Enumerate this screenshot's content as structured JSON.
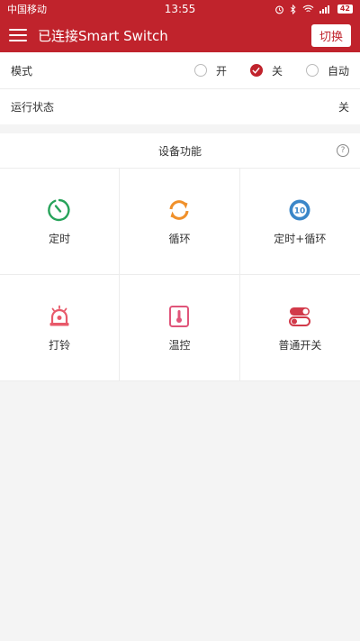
{
  "status_bar": {
    "carrier": "中国移动",
    "time": "13:55",
    "battery": "42"
  },
  "app_bar": {
    "title": "已连接Smart Switch",
    "switch_label": "切换"
  },
  "mode": {
    "label": "模式",
    "options": [
      "开",
      "关",
      "自动"
    ],
    "selected_index": 1
  },
  "run_status": {
    "label": "运行状态",
    "value": "关"
  },
  "features": {
    "title": "设备功能",
    "help": "?",
    "items": [
      {
        "label": "定时",
        "icon": "timer-icon"
      },
      {
        "label": "循环",
        "icon": "loop-icon"
      },
      {
        "label": "定时+循环",
        "icon": "timer-loop-icon"
      },
      {
        "label": "打铃",
        "icon": "bell-icon"
      },
      {
        "label": "温控",
        "icon": "thermometer-icon"
      },
      {
        "label": "普通开关",
        "icon": "toggle-icon"
      }
    ]
  },
  "colors": {
    "primary": "#c0232c",
    "timer": "#27a35a",
    "loop": "#f0902a",
    "timer_loop": "#3a86c8",
    "bell": "#e8596a",
    "thermo": "#e0557a",
    "toggle": "#d23a4a"
  }
}
